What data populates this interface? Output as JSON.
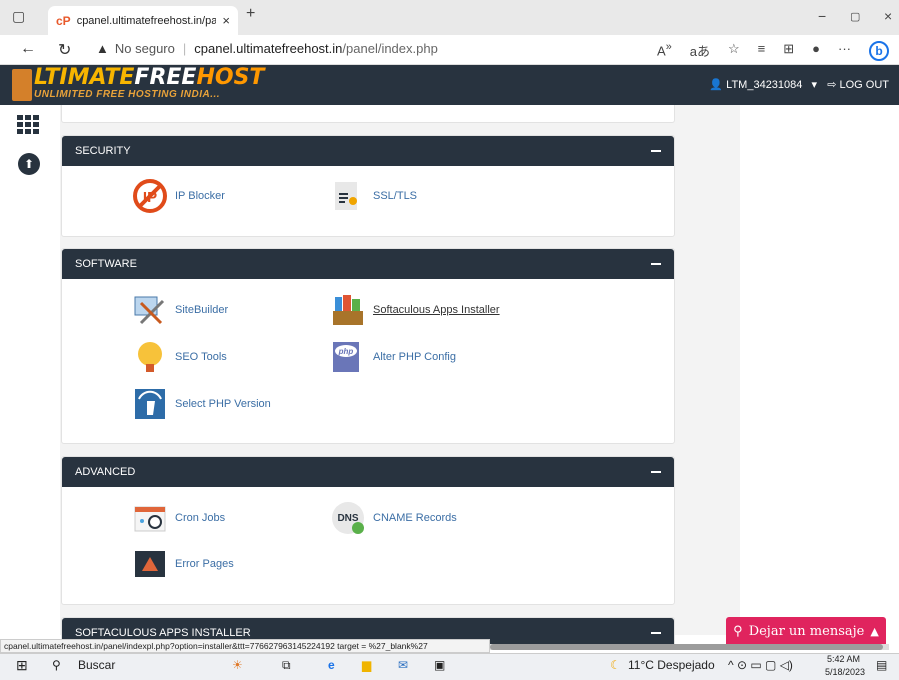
{
  "browser": {
    "tab_title": "cpanel.ultimatefreehost.in/panel",
    "tab_close": "×",
    "new_tab": "+",
    "not_secure": "No seguro",
    "url_host": "cpanel.ultimatefreehost.in",
    "url_path": "/panel/index.php",
    "win_min": "−",
    "win_max": "▢",
    "win_close": "×"
  },
  "header": {
    "logo_line1_a": "LTIMATE",
    "logo_line1_b": "FREE",
    "logo_line1_c": "HOST",
    "logo_line2": "UNLIMITED FREE HOSTING INDIA...",
    "user": "LTM_34231084",
    "logout": "LOG OUT"
  },
  "sections": [
    {
      "title": "SECURITY",
      "items": [
        {
          "label": "IP Blocker",
          "icon": "ip-blocker-icon"
        },
        {
          "label": "SSL/TLS",
          "icon": "ssl-icon"
        }
      ]
    },
    {
      "title": "SOFTWARE",
      "items": [
        {
          "label": "SiteBuilder",
          "icon": "sitebuilder-icon"
        },
        {
          "label": "Softaculous Apps Installer",
          "icon": "softaculous-icon"
        },
        {
          "label": "SEO Tools",
          "icon": "lightbulb-icon"
        },
        {
          "label": "Alter PHP Config",
          "icon": "php-icon"
        },
        {
          "label": "Select PHP Version",
          "icon": "php-version-icon"
        }
      ]
    },
    {
      "title": "ADVANCED",
      "items": [
        {
          "label": "Cron Jobs",
          "icon": "cron-icon"
        },
        {
          "label": "CNAME Records",
          "icon": "dns-icon"
        },
        {
          "label": "Error Pages",
          "icon": "error-pages-icon"
        }
      ]
    },
    {
      "title": "SOFTACULOUS APPS INSTALLER",
      "items": []
    }
  ],
  "dns_badge": "DNS",
  "php_badge": "php",
  "status_url": "cpanel.ultimatefreehost.in/panel/indexpl.php?option=installer&ttt=776627963145224192 target = %27_blank%27",
  "chat_label": "Dejar un mensaje",
  "taskbar": {
    "search": "Buscar",
    "weather": "11°C Despejado",
    "time": "5:42 AM",
    "date": "5/18/2023"
  },
  "colors": {
    "header_bg": "#28333f",
    "link": "#3b6ea5",
    "chat": "#e0245e"
  }
}
